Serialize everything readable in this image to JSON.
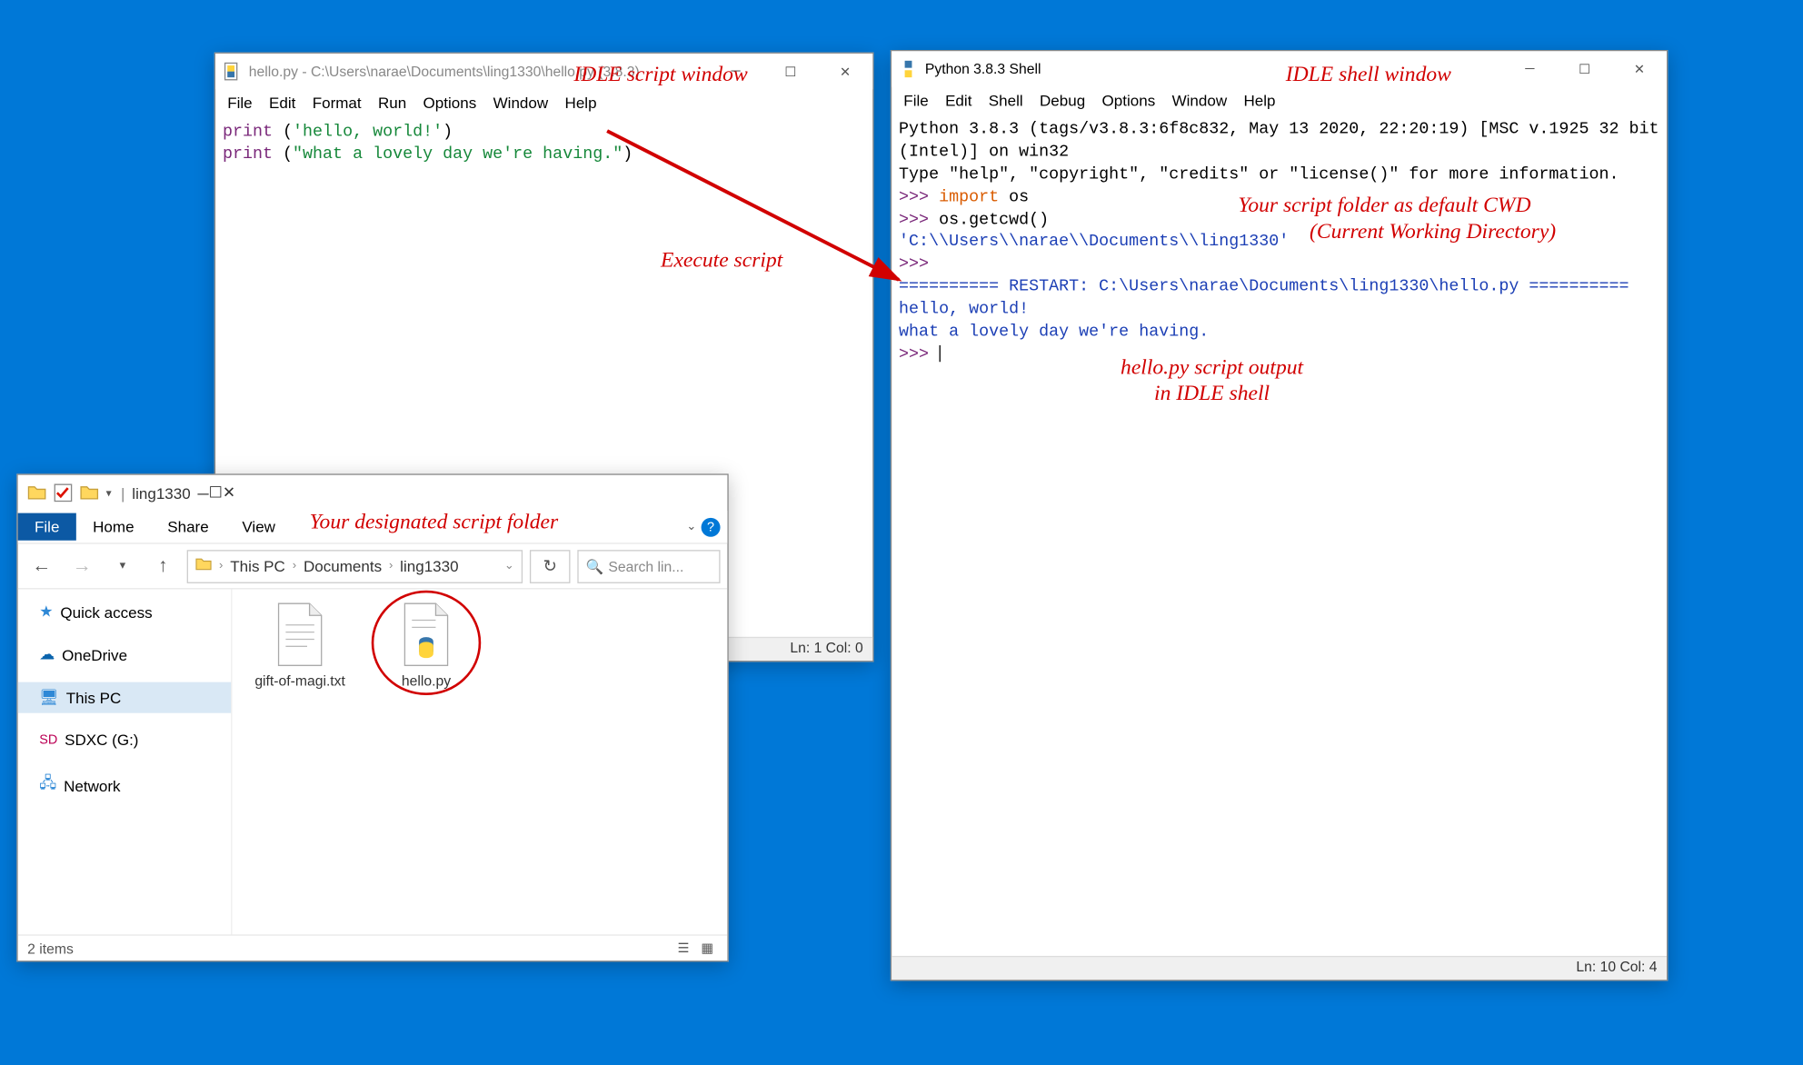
{
  "script_window": {
    "title": "hello.py - C:\\Users\\narae\\Documents\\ling1330\\hello.py (3.8.3)",
    "menus": [
      "File",
      "Edit",
      "Format",
      "Run",
      "Options",
      "Window",
      "Help"
    ],
    "code": {
      "line1_print": "print",
      "line1_paren_open": " (",
      "line1_str": "'hello, world!'",
      "line1_paren_close": ")",
      "line2_print": "print",
      "line2_paren_open": " (",
      "line2_str": "\"what a lovely day we're having.\"",
      "line2_paren_close": ")"
    },
    "status": "Ln: 1  Col: 0"
  },
  "shell_window": {
    "title": "Python 3.8.3 Shell",
    "menus": [
      "File",
      "Edit",
      "Shell",
      "Debug",
      "Options",
      "Window",
      "Help"
    ],
    "banner1": "Python 3.8.3 (tags/v3.8.3:6f8c832, May 13 2020, 22:20:19) [MSC v.1925 32 bit (Intel)] on win32",
    "banner2": "Type \"help\", \"copyright\", \"credits\" or \"license()\" for more information.",
    "prompt": ">>>",
    "import_kw": "import",
    "import_mod": " os",
    "getcwd_call": " os.getcwd()",
    "cwd_result": "'C:\\\\Users\\\\narae\\\\Documents\\\\ling1330'",
    "restart_line": "========== RESTART: C:\\Users\\narae\\Documents\\ling1330\\hello.py ==========",
    "out1": "hello, world!",
    "out2": "what a lovely day we're having.",
    "status": "Ln: 10  Col: 4"
  },
  "explorer": {
    "title_folder": "ling1330",
    "ribbon": {
      "file": "File",
      "home": "Home",
      "share": "Share",
      "view": "View"
    },
    "breadcrumb": [
      "This PC",
      "Documents",
      "ling1330"
    ],
    "search_placeholder": "Search lin...",
    "nav": {
      "quick": "Quick access",
      "onedrive": "OneDrive",
      "thispc": "This PC",
      "sdxc": "SDXC (G:)",
      "network": "Network"
    },
    "files": [
      {
        "name": "gift-of-magi.txt"
      },
      {
        "name": "hello.py"
      }
    ],
    "status": "2 items"
  },
  "annotations": {
    "script_label": "IDLE script window",
    "shell_label": "IDLE shell window",
    "execute": "Execute script",
    "cwd_label1": "Your script folder as default CWD",
    "cwd_label2": "(Current Working Directory)",
    "output_label1": "hello.py script output",
    "output_label2": "in IDLE shell",
    "folder_label": "Your designated script folder"
  }
}
